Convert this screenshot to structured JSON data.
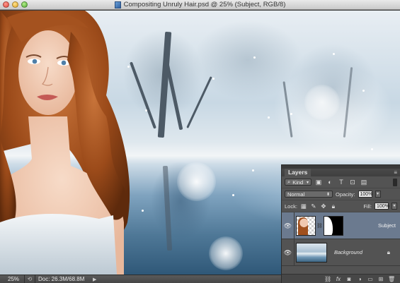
{
  "window": {
    "title": "Compositing Unruly Hair.psd @ 25% (Subject, RGB/8)"
  },
  "status_bar": {
    "zoom": "25%",
    "doc_size": "Doc: 26.3M/68.8M"
  },
  "layers_panel": {
    "tab_label": "Layers",
    "filter": {
      "kind_label": "Kind",
      "icons": [
        "pixel-filter-icon",
        "adjustment-filter-icon",
        "type-filter-icon",
        "shape-filter-icon",
        "smart-object-filter-icon"
      ]
    },
    "blend_mode": "Normal",
    "opacity_label": "Opacity:",
    "opacity_value": "100%",
    "lock_label": "Lock:",
    "fill_label": "Fill:",
    "fill_value": "100%",
    "layers": [
      {
        "name": "Subject",
        "visible": true,
        "selected": true,
        "has_mask": true
      },
      {
        "name": "Background",
        "visible": true,
        "selected": false,
        "locked": true
      }
    ],
    "footer_icons": [
      "link-layers-icon",
      "fx-icon",
      "add-mask-icon",
      "adjustment-layer-icon",
      "new-group-icon",
      "new-layer-icon",
      "trash-icon"
    ]
  },
  "colors": {
    "panel_bg": "#535353",
    "selected_layer": "#6b7a8f",
    "titlebar": "#d5d5d5"
  }
}
